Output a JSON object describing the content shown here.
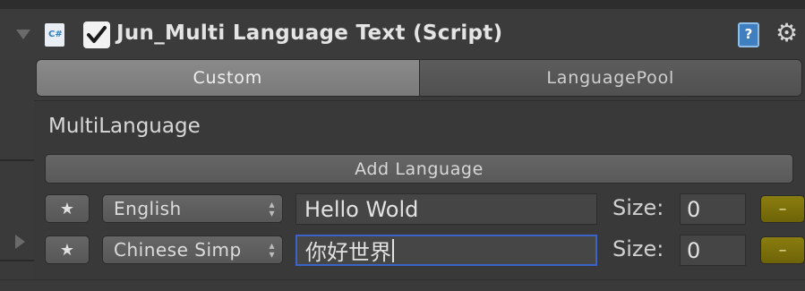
{
  "component": {
    "title": "Jun_Multi Language Text (Script)",
    "script_icon_label": "C#",
    "help_icon": "?",
    "gear_icon": "⚙",
    "enabled": true
  },
  "tabs": [
    {
      "label": "Custom",
      "active": true
    },
    {
      "label": "LanguagePool",
      "active": false
    }
  ],
  "section": {
    "title": "MultiLanguage",
    "add_button": "Add Language"
  },
  "rows": [
    {
      "star": "★",
      "language": "English",
      "text": "Hello Wold",
      "size_label": "Size:",
      "size": "0",
      "remove": "–",
      "focused": false
    },
    {
      "star": "★",
      "language": "Chinese Simp",
      "text": "你好世界",
      "size_label": "Size:",
      "size": "0",
      "remove": "–",
      "focused": true
    }
  ],
  "colors": {
    "background": "#3a3a3a",
    "focus_border": "#3c63c8",
    "remove_button": "#7a6e0b"
  }
}
